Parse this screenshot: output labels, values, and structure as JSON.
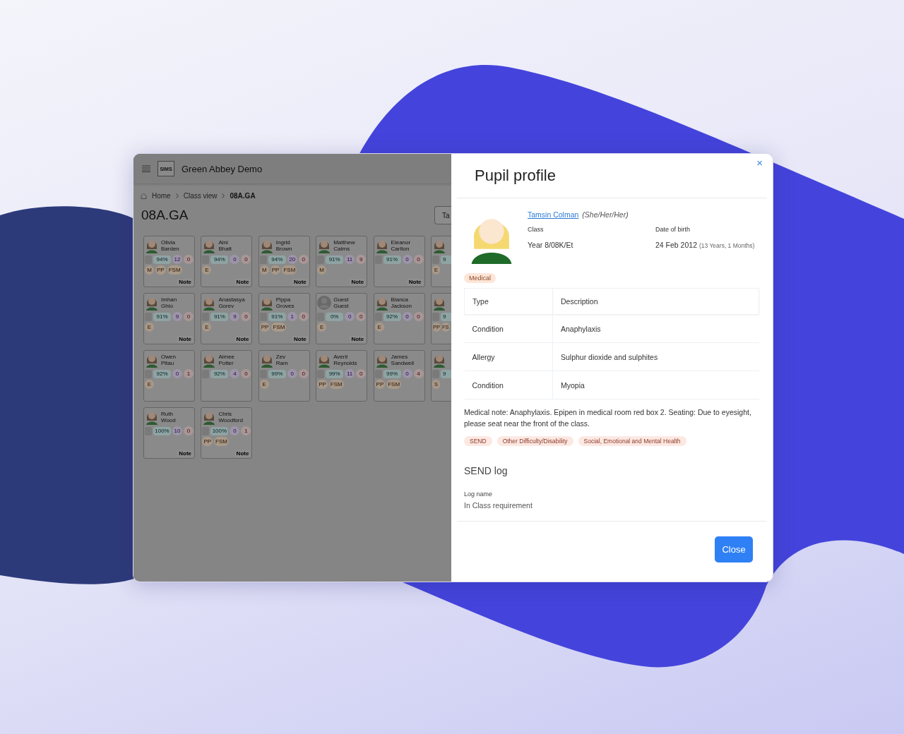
{
  "app": {
    "logo": "SIMS",
    "title": "Green Abbey Demo"
  },
  "breadcrumbs": [
    {
      "label": "Home",
      "kind": "home"
    },
    {
      "label": "Class view",
      "kind": "link"
    },
    {
      "label": "08A.GA",
      "kind": "current"
    }
  ],
  "page_title": "08A.GA",
  "header_button": "Ta",
  "pupils": [
    {
      "kind": "full",
      "first": "Olivia",
      "last": "Barden",
      "attendance": "94%",
      "count_a": "12",
      "count_b": "0",
      "badges": [
        "M",
        "PP",
        "FSM"
      ],
      "note": "Note"
    },
    {
      "kind": "full",
      "first": "Aini",
      "last": "Bhatt",
      "attendance": "94%",
      "count_a": "0",
      "count_b": "0",
      "badges": [
        "E"
      ],
      "note": "Note"
    },
    {
      "kind": "full",
      "first": "Ingrid",
      "last": "Brown",
      "attendance": "94%",
      "count_a": "20",
      "count_b": "0",
      "badges": [
        "M",
        "PP",
        "FSM"
      ],
      "note": "Note"
    },
    {
      "kind": "full",
      "first": "Matthew",
      "last": "Cairns",
      "attendance": "91%",
      "count_a": "11",
      "count_b": "9",
      "badges": [
        "M"
      ],
      "note": "Note"
    },
    {
      "kind": "full",
      "first": "Eleanor",
      "last": "Carlton",
      "attendance": "91%",
      "count_a": "0",
      "count_b": "0",
      "note": "Note"
    },
    {
      "kind": "partial",
      "attendance": "9",
      "badges": [
        "E"
      ]
    },
    {
      "kind": "full",
      "first": "Imhan",
      "last": "Ghio",
      "attendance": "91%",
      "count_a": "9",
      "count_b": "0",
      "badges": [
        "E"
      ],
      "note": "Note"
    },
    {
      "kind": "full",
      "first": "Anastasya",
      "last": "Gorev",
      "attendance": "91%",
      "count_a": "9",
      "count_b": "0",
      "badges": [
        "E"
      ],
      "note": "Note"
    },
    {
      "kind": "full",
      "first": "Pippa",
      "last": "Groves",
      "attendance": "91%",
      "count_a": "1",
      "count_b": "0",
      "badges": [
        "PP",
        "FSM"
      ],
      "note": "Note"
    },
    {
      "kind": "guest",
      "first": "Guest",
      "last": "Guest",
      "attendance": "0%",
      "count_a": "0",
      "count_b": "0",
      "badges": [
        "E"
      ],
      "note": "Note"
    },
    {
      "kind": "full",
      "first": "Bianca",
      "last": "Jackson",
      "attendance": "92%",
      "count_a": "0",
      "count_b": "0",
      "badges": [
        "E"
      ]
    },
    {
      "kind": "partial",
      "attendance": "9",
      "badges": [
        "PP",
        "FS"
      ]
    },
    {
      "kind": "full",
      "first": "Owen",
      "last": "Pitau",
      "attendance": "92%",
      "count_a": "0",
      "count_b": "1",
      "badges": [
        "E"
      ]
    },
    {
      "kind": "full",
      "first": "Aimee",
      "last": "Potter",
      "attendance": "92%",
      "count_a": "4",
      "count_b": "0"
    },
    {
      "kind": "full",
      "first": "Zev",
      "last": "Ram",
      "attendance": "99%",
      "count_a": "0",
      "count_b": "0",
      "badges": [
        "E"
      ]
    },
    {
      "kind": "full",
      "first": "Averil",
      "last": "Reynolds",
      "attendance": "99%",
      "count_a": "11",
      "count_b": "0",
      "badges": [
        "PP",
        "FSM"
      ]
    },
    {
      "kind": "full",
      "first": "James",
      "last": "Sandwell",
      "attendance": "99%",
      "count_a": "0",
      "count_b": "4",
      "badges": [
        "PP",
        "FSM"
      ]
    },
    {
      "kind": "partial",
      "attendance": "9",
      "badges": [
        "S"
      ]
    },
    {
      "kind": "full",
      "first": "Ruth",
      "last": "Wood",
      "attendance": "100%",
      "count_a": "10",
      "count_b": "0",
      "note": "Note"
    },
    {
      "kind": "full",
      "first": "Chris",
      "last": "Woodford",
      "attendance": "100%",
      "count_a": "0",
      "count_b": "1",
      "badges": [
        "PP",
        "FSM"
      ],
      "note": "Note"
    }
  ],
  "profile": {
    "title": "Pupil profile",
    "close_icon": "×",
    "name": "Tamsin Colman",
    "pronouns": "(She/Her/Her)",
    "class_label": "Class",
    "class_value": "Year 8/08K/Et",
    "dob_label": "Date of birth",
    "dob_value": "24 Feb 2012",
    "age": "(13 Years, 1 Months)",
    "tag": "Medical",
    "table": {
      "columns": [
        "Type",
        "Description"
      ],
      "rows": [
        [
          "Condition",
          "Anaphylaxis"
        ],
        [
          "Allergy",
          "Sulphur dioxide and sulphites"
        ],
        [
          "Condition",
          "Myopia"
        ]
      ]
    },
    "medical_note": "Medical note: Anaphylaxis. Epipen in medical room red box 2. Seating: Due to eyesight, please seat near the front of the class.",
    "send_tags": [
      "SEND",
      "Other Difficulty/Disability",
      "Social, Emotional and Mental Health"
    ],
    "send_log_title": "SEND log",
    "log_label": "Log name",
    "log_value": "In Class requirement",
    "button": "Close"
  }
}
